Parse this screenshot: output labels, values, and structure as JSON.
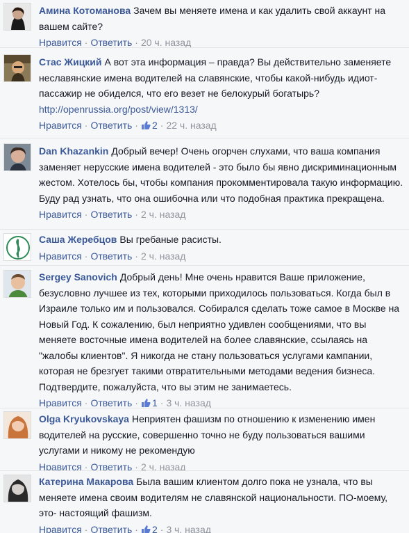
{
  "actions": {
    "like_label": "Нравится",
    "reply_label": "Ответить"
  },
  "comments": [
    {
      "author": "Амина Котоманова",
      "text": "Зачем вы меняете имена и как удалить свой аккаунт на вашем сайте?",
      "time": "20 ч. назад",
      "likes": ""
    },
    {
      "author": "Стас Жицкий",
      "text": "А вот эта информация – правда? Вы действительно заменяете неславянские имена водителей на славянские, чтобы какой-нибудь идиот-пассажир не обиделся, что его везет не белокурый богатырь?",
      "link": "http://openrussia.org/post/view/1313/",
      "time": "22 ч. назад",
      "likes": "2"
    },
    {
      "author": "Dan Khazankin",
      "text": "Добрый вечер! Очень огорчен слухами, что ваша компания заменяет нерусские имена водителей - это было бы явно дискриминационным жестом. Хотелось бы, чтобы компания прокомментировала такую информацию. Буду рад узнать, что она ошибочна или что подобная практика прекращена.",
      "time": "2 ч. назад",
      "likes": ""
    },
    {
      "author": "Саша Жеребцов",
      "text": "Вы гребаные расисты.",
      "time": "2 ч. назад",
      "likes": ""
    },
    {
      "author": "Sergey Sanovich",
      "text": "Добрый день! Мне очень нравится Ваше приложение, безусловно лучшее из тех, которыми приходилось пользоваться. Когда был в Израиле только им и пользовался. Собирался сделать тоже самое в Москве на Новый Год. К сожалению, был неприятно удивлен сообщениями, что вы меняете восточные имена водителей на более славянские, ссылаясь на \"жалобы клиентов\". Я никогда не стану пользоваться услугами кампании, которая не брезгует такими отвратительными методами ведения бизнеса. Подтвердите, пожалуйста, что вы этим не занимаетесь.",
      "time": "3 ч. назад",
      "likes": "1"
    },
    {
      "author": "Olga Kryukovskaya",
      "text": "Неприятен фашизм по отношению к изменению имен водителей на русские, совершенно точно не буду пользоваться вашими услугами и никому не рекомендую",
      "time": "2 ч. назад",
      "likes": ""
    },
    {
      "author": "Катерина Макарова",
      "text": "Была вашим клиентом долго пока не узнала, что вы меняете имена своим водителям не славянской национальности. ПО-моему, это- настоящий фашизм.",
      "time": "3 ч. назад",
      "likes": "2"
    }
  ]
}
